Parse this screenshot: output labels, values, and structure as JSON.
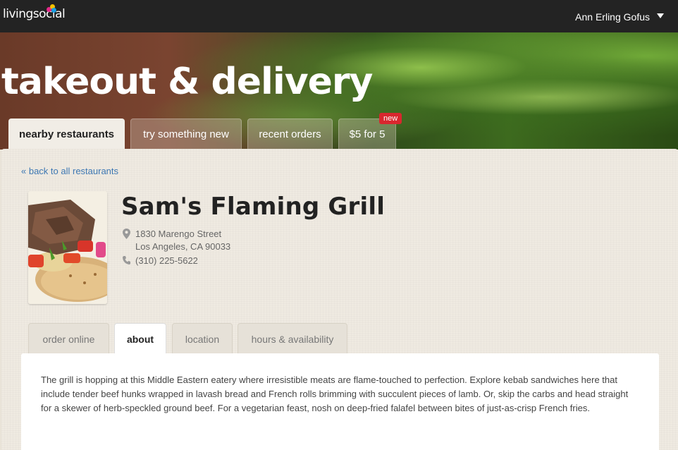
{
  "topbar": {
    "logo_text": "livingsocial",
    "logo_colors": [
      "#e6288a",
      "#f7c100",
      "#1b9fe3",
      "#7ac142"
    ],
    "user_name": "Ann Erling Gofus",
    "user_menu_icon": "caret-down-icon"
  },
  "hero": {
    "title": "takeout & delivery"
  },
  "main_tabs": [
    {
      "label": "nearby restaurants",
      "active": true
    },
    {
      "label": "try something new",
      "active": false
    },
    {
      "label": "recent orders",
      "active": false
    },
    {
      "label": "$5 for 5",
      "active": false
    }
  ],
  "new_badge": "new",
  "back_link": "« back to all restaurants",
  "restaurant": {
    "name": "Sam's Flaming Grill",
    "address_line1": "1830 Marengo Street",
    "address_line2": "Los Angeles, CA 90033",
    "phone": "(310) 225-5622",
    "address_icon": "map-pin-icon",
    "phone_icon": "phone-icon"
  },
  "sub_tabs": [
    {
      "label": "order online",
      "active": false
    },
    {
      "label": "about",
      "active": true
    },
    {
      "label": "location",
      "active": false
    },
    {
      "label": "hours & availability",
      "active": false
    }
  ],
  "about_text": "The grill is hopping at this Middle Eastern eatery where irresistible meats are flame-touched to perfection. Explore kebab sandwiches here that include tender beef hunks wrapped in lavash bread and French rolls brimming with succulent pieces of lamb. Or, skip the carbs and head straight for a skewer of herb-speckled ground beef. For a vegetarian feast, nosh on deep-fried falafel between bites of just-as-crisp French fries."
}
